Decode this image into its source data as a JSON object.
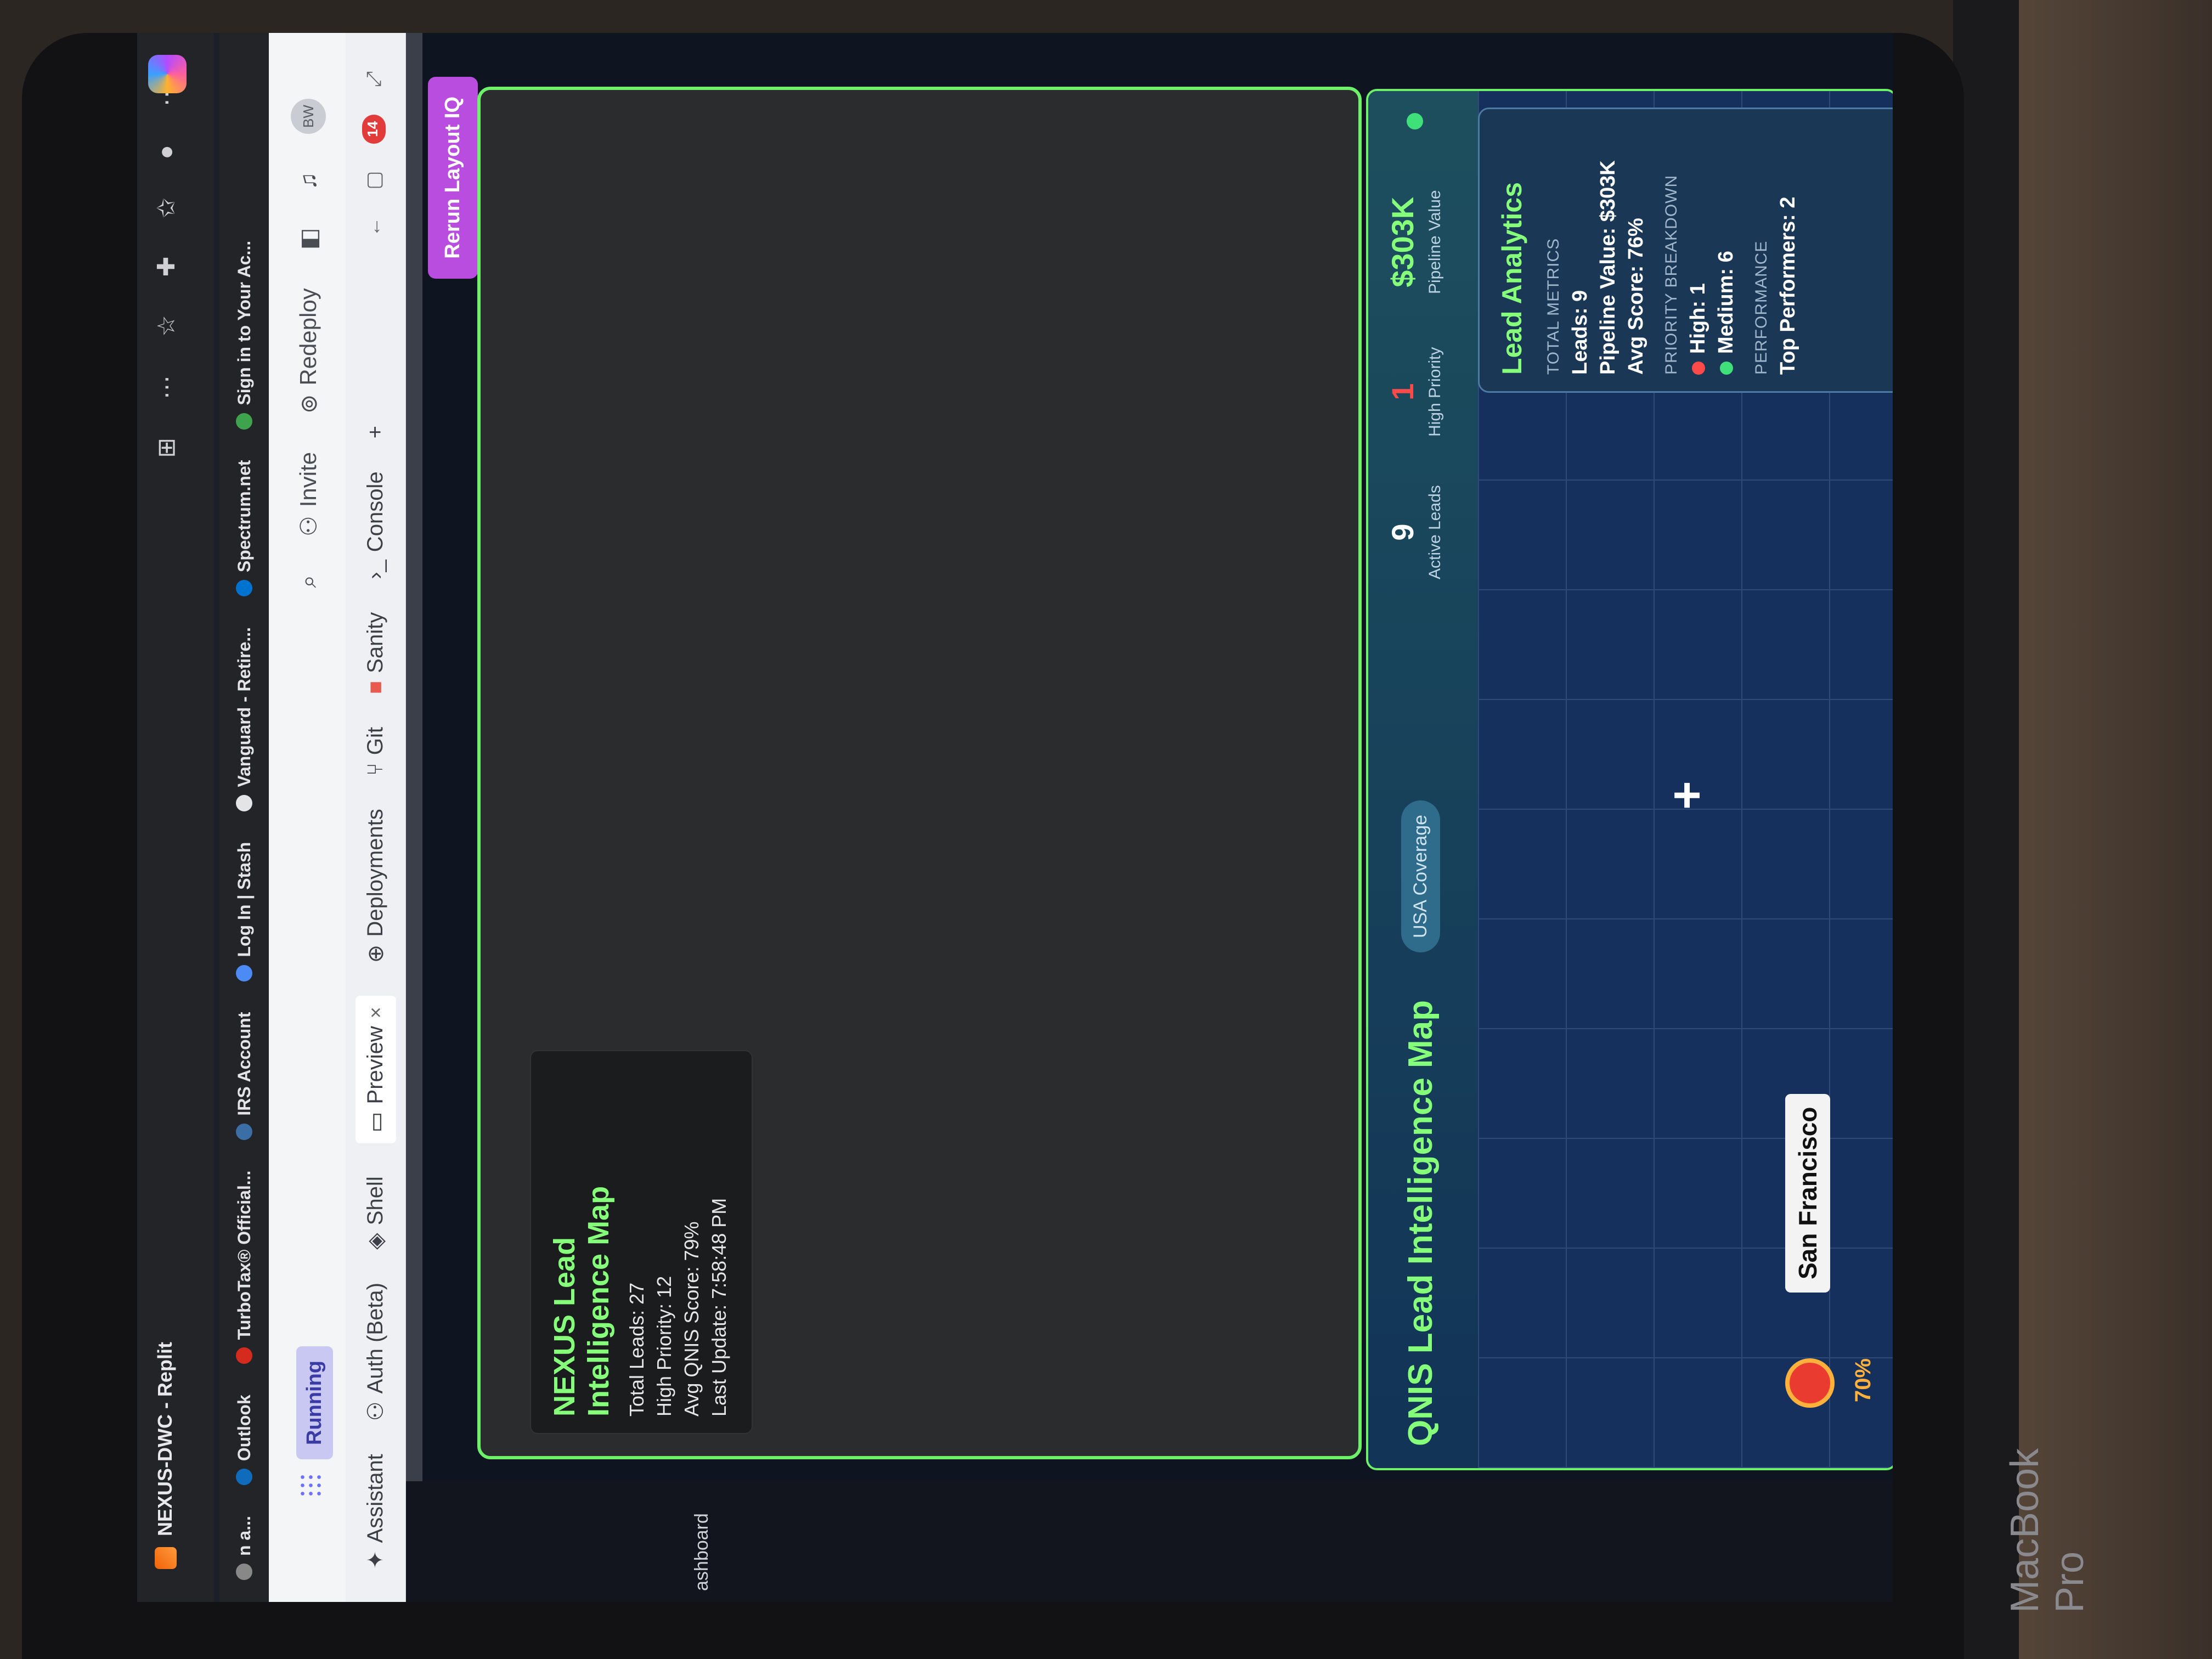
{
  "device": {
    "brand": "MacBook Pro"
  },
  "browser": {
    "tab_title": "NEXUS-DWC - Replit",
    "bookmarks": [
      {
        "label": "n a...",
        "color": "#888888"
      },
      {
        "label": "Outlook",
        "color": "#0f6cbd"
      },
      {
        "label": "TurboTax® Official...",
        "color": "#d52b1e"
      },
      {
        "label": "IRS Account",
        "color": "#3b6ea5"
      },
      {
        "label": "Log In | Stash",
        "color": "#4c8bf5"
      },
      {
        "label": "Vanguard - Retire...",
        "color": "#e4e4e6"
      },
      {
        "label": "Spectrum.net",
        "color": "#0073d1"
      },
      {
        "label": "Sign in to Your Ac...",
        "color": "#3fa34d"
      }
    ]
  },
  "replit": {
    "status": "Running",
    "invite_label": "Invite",
    "redeploy_label": "Redeploy",
    "avatar_initials": "BW",
    "tabs": [
      {
        "label": "Assistant"
      },
      {
        "label": "Auth (Beta)"
      },
      {
        "label": "Shell"
      },
      {
        "label": "Preview"
      },
      {
        "label": "Deployments"
      },
      {
        "label": "Git"
      },
      {
        "label": "Sanity"
      },
      {
        "label": "Console"
      }
    ],
    "notification_count": "14",
    "left_label": "ashboard"
  },
  "app": {
    "rerun_label": "Rerun Layout IQ",
    "map_info": {
      "title": "NEXUS Lead Intelligence Map",
      "total_leads": "Total Leads: 27",
      "high_priority": "High Priority: 12",
      "avg_score": "Avg QNIS Score: 79%",
      "last_update": "Last Update: 7:58:48 PM"
    },
    "qnis": {
      "title": "QNIS Lead Intelligence Map",
      "coverage": "USA Coverage",
      "stats": [
        {
          "value": "9",
          "label": "Active Leads",
          "color": "#ffffff"
        },
        {
          "value": "1",
          "label": "High Priority",
          "color": "#ff4a4a"
        },
        {
          "value": "$303K",
          "label": "Pipeline Value",
          "color": "#86ff7a"
        }
      ],
      "marker": {
        "city": "San Francisco",
        "pct": "70%"
      }
    },
    "analytics": {
      "title": "Lead Analytics",
      "total_metrics_heading": "TOTAL METRICS",
      "leads": "Leads: 9",
      "pipeline": "Pipeline Value: $303K",
      "avg": "Avg Score: 76%",
      "priority_heading": "PRIORITY BREAKDOWN",
      "high": "High: 1",
      "medium": "Medium: 6",
      "performance_heading": "PERFORMANCE",
      "top_performers": "Top Performers: 2"
    }
  }
}
